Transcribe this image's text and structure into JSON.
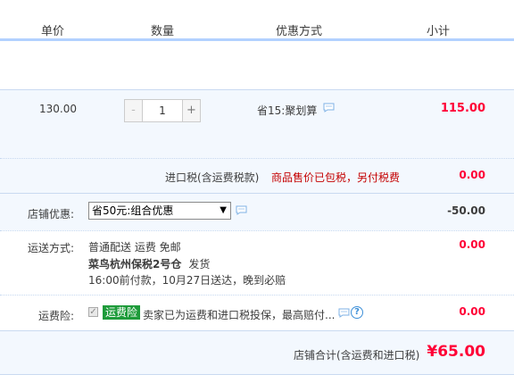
{
  "header": {
    "unit_price": "单价",
    "quantity": "数量",
    "discount_method": "优惠方式",
    "subtotal": "小计"
  },
  "item": {
    "price": "130.00",
    "quantity": "1",
    "minus_label": "-",
    "plus_label": "+",
    "promo": "省15:聚划算",
    "subtotal": "115.00"
  },
  "import_tax": {
    "label": "进口税(含运费税款)",
    "note": "商品售价已包税，另付税费",
    "value": "0.00"
  },
  "shop_discount": {
    "label": "店铺优惠:",
    "selected": "省50元:组合优惠",
    "value": "-50.00"
  },
  "shipping": {
    "label": "运送方式:",
    "line1": "普通配送 运费 免邮",
    "warehouse": "菜鸟杭州保税2号仓",
    "ship_status": "发货",
    "line3": "16:00前付款，10月27日送达，晚到必赔",
    "value": "0.00"
  },
  "insurance": {
    "label": "运费险:",
    "checked_glyph": "✓",
    "tag": "运费险",
    "description": "卖家已为运费和进口税投保，最高赔付...",
    "help_glyph": "?",
    "value": "0.00"
  },
  "total": {
    "label": "店铺合计(含运费和进口税)",
    "value": "¥65.00"
  },
  "icons": [
    "chat-icon",
    "help-icon",
    "dropdown-arrow-icon",
    "checkbox-icon"
  ],
  "colors": {
    "accent_red": "#ff0036",
    "tax_note_red": "#c40000",
    "insurance_green": "#1e9b3a",
    "row_bg": "#f3f8fe",
    "header_border": "#b2d1ff"
  }
}
